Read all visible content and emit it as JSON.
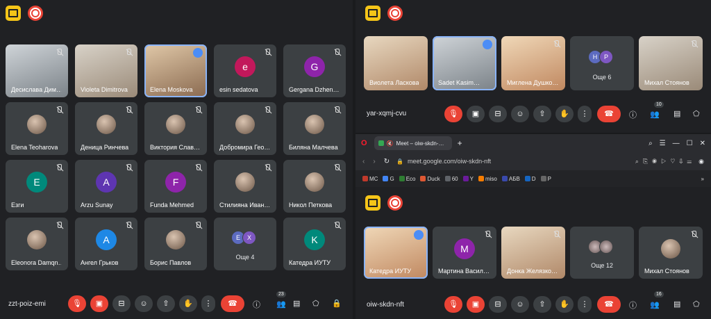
{
  "left": {
    "meeting_code": "zzt-poiz-emi",
    "participants_count": "23",
    "tiles": [
      {
        "name": "Десислава Дим…",
        "kind": "video",
        "muted": true
      },
      {
        "name": "Violeta Dimitrova",
        "kind": "video",
        "muted": true
      },
      {
        "name": "Elena Moskova",
        "kind": "video",
        "speaking": true
      },
      {
        "name": "esin sedatova",
        "kind": "avatar",
        "letter": "e",
        "color": "#c2185b",
        "muted": true
      },
      {
        "name": "Gergana Dzhen…",
        "kind": "avatar",
        "letter": "G",
        "color": "#8e24aa",
        "muted": true
      },
      {
        "name": "Elena Teoharova",
        "kind": "photo",
        "muted": true
      },
      {
        "name": "Деница Ринчева",
        "kind": "photo",
        "muted": true
      },
      {
        "name": "Виктория Слав…",
        "kind": "photo",
        "muted": true
      },
      {
        "name": "Добромира Гео…",
        "kind": "photo",
        "muted": true
      },
      {
        "name": "Биляна Малчева",
        "kind": "photo",
        "muted": true
      },
      {
        "name": "Езги",
        "kind": "avatar",
        "letter": "E",
        "color": "#00897b",
        "muted": true
      },
      {
        "name": "Arzu Sunay",
        "kind": "avatar",
        "letter": "A",
        "color": "#5e35b1",
        "muted": true
      },
      {
        "name": "Funda Mehmed",
        "kind": "avatar",
        "letter": "F",
        "color": "#8e24aa",
        "muted": true
      },
      {
        "name": "Стилияна Иван…",
        "kind": "photo",
        "muted": true
      },
      {
        "name": "Никол Петкова",
        "kind": "photo",
        "muted": true
      },
      {
        "name": "Eleonora Damqn…",
        "kind": "photo",
        "muted": true
      },
      {
        "name": "Ангел Грьков",
        "kind": "avatar",
        "letter": "A",
        "color": "#1e88e5",
        "muted": true
      },
      {
        "name": "Борис Павлов",
        "kind": "photo",
        "muted": true
      },
      {
        "name": "Още 4",
        "kind": "more",
        "letters": [
          "E",
          "X"
        ]
      },
      {
        "name": "Катедра ИУТУ",
        "kind": "avatar",
        "letter": "K",
        "color": "#00897b",
        "muted": true
      }
    ]
  },
  "right_top": {
    "meeting_code": "yar-xqmj-cvu",
    "participants_count": "10",
    "tiles": [
      {
        "name": "Виолета Ласкова",
        "kind": "video"
      },
      {
        "name": "Sadet Kasim…",
        "kind": "video",
        "active": true
      },
      {
        "name": "Миглена Душко…",
        "kind": "video",
        "muted": true
      },
      {
        "name": "Още 6",
        "kind": "more",
        "letters": [
          "H",
          "P"
        ]
      },
      {
        "name": "Михал Стоянов",
        "kind": "video",
        "muted": true
      }
    ]
  },
  "browser": {
    "tab_title": "Meet – oiw-skdn-…",
    "url": "meet.google.com/oiw-skdn-nft",
    "bookmarks": [
      "MC",
      "G",
      "Eco",
      "Duck",
      "60",
      "Y",
      "miso",
      "АБВ",
      "D",
      "P"
    ],
    "more": "»"
  },
  "right_bottom": {
    "meeting_code": "oiw-skdn-nft",
    "participants_count": "16",
    "tiles": [
      {
        "name": "Катедра ИУТУ",
        "kind": "video",
        "active": true
      },
      {
        "name": "Мартина Васил…",
        "kind": "avatar",
        "letter": "M",
        "color": "#8e24aa",
        "muted": true
      },
      {
        "name": "Донка Желязко…",
        "kind": "video",
        "muted": true
      },
      {
        "name": "Още 12",
        "kind": "more"
      },
      {
        "name": "Михал Стоянов",
        "kind": "photo",
        "muted": true
      }
    ]
  }
}
